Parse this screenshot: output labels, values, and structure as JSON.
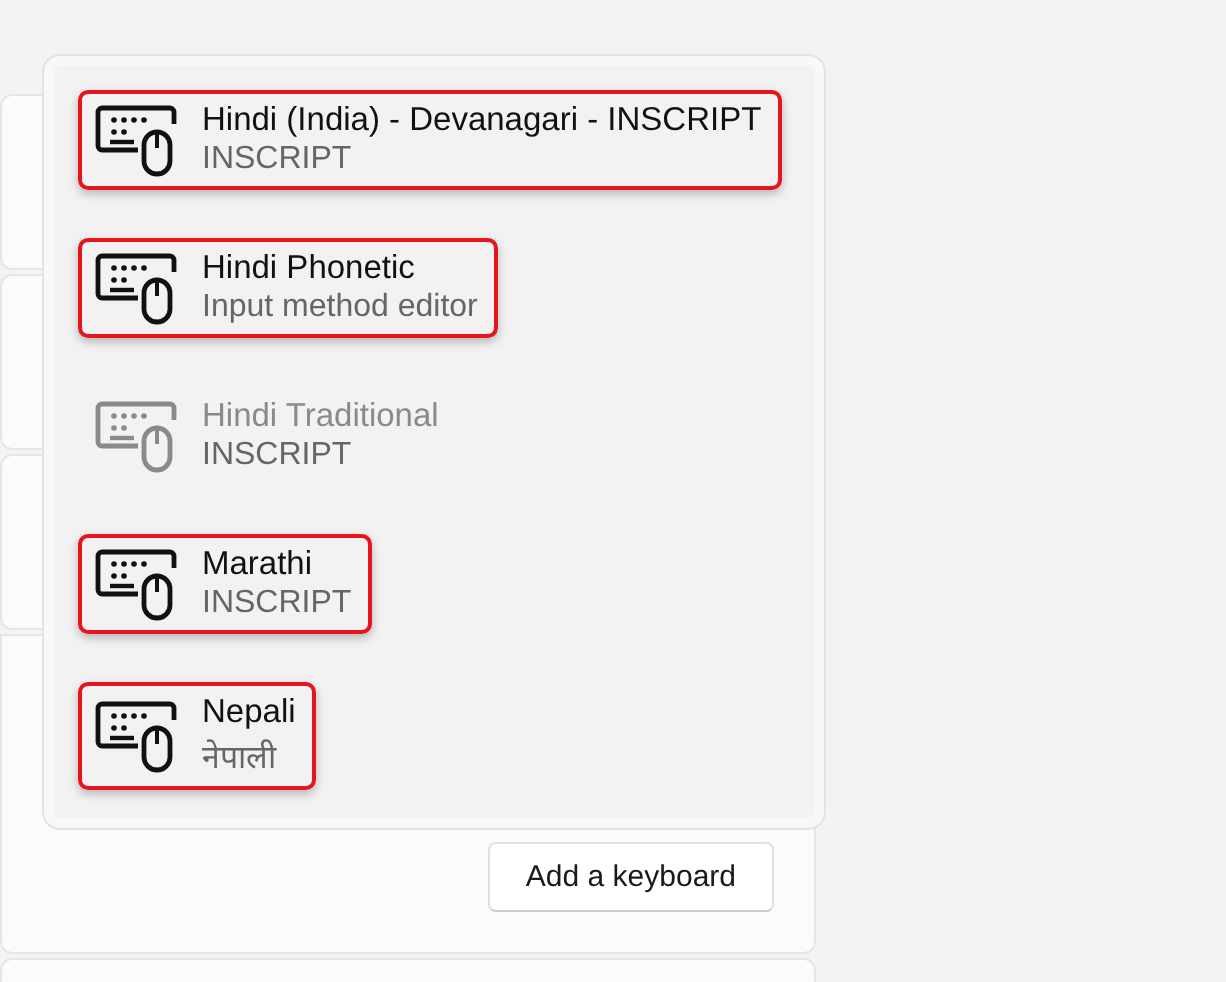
{
  "keyboard_menu": {
    "items": [
      {
        "name": "Hindi (India) - Devanagari - INSCRIPT",
        "detail": "INSCRIPT",
        "disabled": false,
        "highlighted": true
      },
      {
        "name": "Hindi Phonetic",
        "detail": "Input method editor",
        "disabled": false,
        "highlighted": true
      },
      {
        "name": "Hindi Traditional",
        "detail": "INSCRIPT",
        "disabled": true,
        "highlighted": false
      },
      {
        "name": "Marathi",
        "detail": "INSCRIPT",
        "disabled": false,
        "highlighted": true
      },
      {
        "name": "Nepali",
        "detail": "नेपाली",
        "disabled": false,
        "highlighted": true
      }
    ]
  },
  "add_button": {
    "label": "Add a keyboard"
  }
}
